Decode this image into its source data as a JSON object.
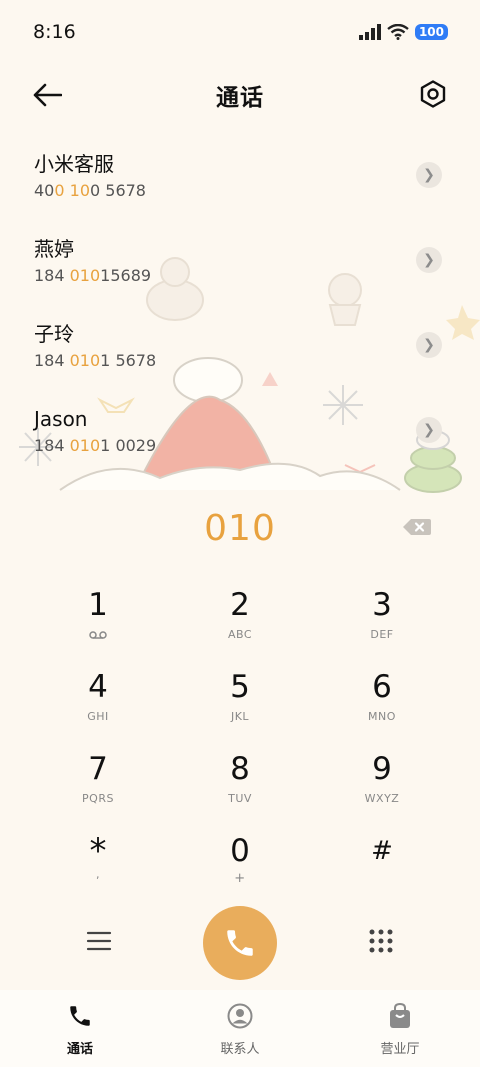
{
  "status_bar": {
    "time": "8:16",
    "battery": "100"
  },
  "header": {
    "title": "通话",
    "back_icon": "arrow-left-icon",
    "settings_icon": "gear-icon"
  },
  "contacts": [
    {
      "name": "小米客服",
      "number_parts": [
        "40",
        "0",
        " ",
        "10",
        "0 5678"
      ]
    },
    {
      "name": "燕婷",
      "number_parts": [
        "184 ",
        "010",
        "15689"
      ]
    },
    {
      "name": "子玲",
      "number_parts": [
        "184 ",
        "010",
        "1 5678"
      ]
    },
    {
      "name": "Jason",
      "number_parts": [
        "184 ",
        "010",
        "1 0029"
      ]
    }
  ],
  "dialer": {
    "input": "010",
    "keys": [
      {
        "digit": "1",
        "letters": "voicemail"
      },
      {
        "digit": "2",
        "letters": "ABC"
      },
      {
        "digit": "3",
        "letters": "DEF"
      },
      {
        "digit": "4",
        "letters": "GHI"
      },
      {
        "digit": "5",
        "letters": "JKL"
      },
      {
        "digit": "6",
        "letters": "MNO"
      },
      {
        "digit": "7",
        "letters": "PQRS"
      },
      {
        "digit": "8",
        "letters": "TUV"
      },
      {
        "digit": "9",
        "letters": "WXYZ"
      },
      {
        "digit": "*",
        "letters": ","
      },
      {
        "digit": "0",
        "letters": "+"
      },
      {
        "digit": "#",
        "letters": ""
      }
    ]
  },
  "bottom_nav": [
    {
      "label": "通话",
      "icon": "phone-icon",
      "active": true
    },
    {
      "label": "联系人",
      "icon": "person-icon",
      "active": false
    },
    {
      "label": "营业厅",
      "icon": "shopping-bag-icon",
      "active": false
    }
  ],
  "colors": {
    "accent": "#e8a23f",
    "call_button": "#e9ad5c",
    "background": "#fdf8f0"
  }
}
